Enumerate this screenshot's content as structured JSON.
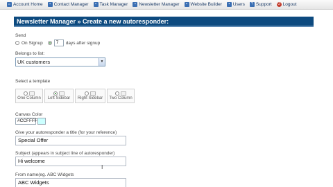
{
  "nav": {
    "items": [
      {
        "label": "Account Home",
        "icon": "home-icon",
        "glyph": "⌂"
      },
      {
        "label": "Contact Manager",
        "icon": "contacts-icon",
        "glyph": "▪"
      },
      {
        "label": "Task Manager",
        "icon": "tasks-icon",
        "glyph": "▪"
      },
      {
        "label": "Newsletter Manager",
        "icon": "newsletter-icon",
        "glyph": "▪"
      },
      {
        "label": "Website Builder",
        "icon": "website-icon",
        "glyph": "▪"
      },
      {
        "label": "Users",
        "icon": "users-icon",
        "glyph": "▪"
      },
      {
        "label": "Support",
        "icon": "support-icon",
        "glyph": "?"
      },
      {
        "label": "Logout",
        "icon": "logout-icon",
        "glyph": "⏻"
      }
    ]
  },
  "header": {
    "title": "Newsletter Manager » Create a new autoresponder:"
  },
  "send": {
    "label": "Send",
    "on_signup_label": "On Signup",
    "days_value": "7",
    "days_after_label": "days after signup",
    "selected": "days"
  },
  "list": {
    "label": "Belongs to list:",
    "selected": "UK customers"
  },
  "template": {
    "label": "Select a template",
    "options": [
      "One Column",
      "Left Sidebar",
      "Right Sidebar",
      "Two Column"
    ],
    "selected_index": 1
  },
  "canvas_color": {
    "label": "Canvas Color",
    "value": "#CCFFFF",
    "swatch": "#ccffff"
  },
  "title_field": {
    "label": "Give your autoresponder a title (for your reference)",
    "value": "Special Offer"
  },
  "subject_field": {
    "label": "Subject (appears in subject line of autoresponder)",
    "value": "Hi welcome"
  },
  "from_field": {
    "label": "From name(eg. ABC Widgets",
    "value": "ABC Widgets"
  },
  "colors": {
    "header_bg": "#0d4a7f",
    "nav_text": "#1a3a66"
  }
}
